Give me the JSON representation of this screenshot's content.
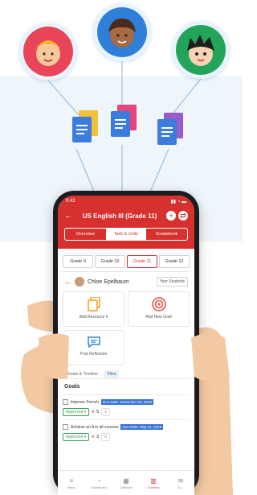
{
  "status": {
    "time": "9:41",
    "signal": "▮▮ ◔ ▬"
  },
  "header": {
    "back_glyph": "←",
    "title": "US English III (Grade 11)",
    "add_glyph": "+",
    "swap_glyph": "⇄"
  },
  "segments": [
    {
      "label": "Overview",
      "active": false
    },
    {
      "label": "Task & Units",
      "active": true
    },
    {
      "label": "Gradebook",
      "active": false
    }
  ],
  "grades": [
    {
      "label": "Grade 9",
      "active": false
    },
    {
      "label": "Grade 10",
      "active": false
    },
    {
      "label": "Grade 11",
      "active": true
    },
    {
      "label": "Grade 12",
      "active": false
    }
  ],
  "student": {
    "back_glyph": "←",
    "name": "Chloe Epelbaum",
    "filter_label": "Your Students"
  },
  "actions": [
    {
      "label": "Add Resource ▾",
      "icon": "document-copy-icon"
    },
    {
      "label": "Add New Goal",
      "icon": "target-icon"
    },
    {
      "label": "Post Reflection",
      "icon": "chat-bubble-icon"
    }
  ],
  "subtabs": [
    {
      "label": "Goals & Timeline",
      "active": false
    },
    {
      "label": "Files",
      "active": true
    }
  ],
  "goals_heading": "Goals",
  "goals": [
    {
      "title": "Improve French",
      "date": "Due Date: November 20, 2018",
      "status": "Approved ▾",
      "likes": "5",
      "comments": "2"
    },
    {
      "title": "Achieve an A in all courses",
      "date": "Due Date: May 31, 2019",
      "status": "Approved ▾",
      "likes": "3",
      "comments": "0"
    }
  ],
  "bottom_nav": [
    {
      "label": "Menu",
      "icon_glyph": "≡",
      "active": false
    },
    {
      "label": "Dashboard",
      "icon_glyph": "◔",
      "active": false
    },
    {
      "label": "Calendar",
      "icon_glyph": "▦",
      "active": false
    },
    {
      "label": "Courses",
      "icon_glyph": "▥",
      "active": true
    },
    {
      "label": "Co...",
      "icon_glyph": "✉",
      "active": false
    }
  ],
  "colors": {
    "brand_red": "#d7312f",
    "approved_green": "#3aa55b",
    "date_blue": "#3b74d4",
    "doc_blue": "#3b7ddd",
    "doc_yellow": "#f3c23a",
    "doc_pink": "#e8457f",
    "doc_purple": "#9b5cc8"
  }
}
